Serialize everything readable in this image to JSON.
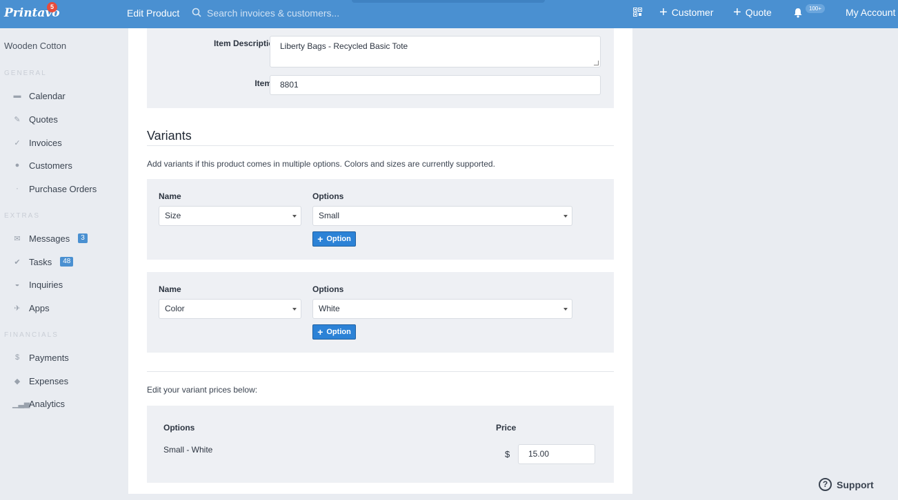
{
  "app": {
    "logo": "Printavo",
    "logo_badge": "5",
    "page_title": "Edit Product"
  },
  "search": {
    "placeholder": "Search invoices & customers..."
  },
  "topnav": {
    "customer": "Customer",
    "quote": "Quote",
    "notifications_badge": "100+",
    "account": "My Account"
  },
  "sidebar": {
    "account_name": "Wooden Cotton",
    "sections": {
      "general": "GENERAL",
      "extras": "EXTRAS",
      "financials": "FINANCIALS"
    },
    "items": {
      "calendar": "Calendar",
      "quotes": "Quotes",
      "invoices": "Invoices",
      "customers": "Customers",
      "purchase_orders": "Purchase Orders",
      "messages": "Messages",
      "messages_count": "3",
      "tasks": "Tasks",
      "tasks_count": "48",
      "inquiries": "Inquiries",
      "apps": "Apps",
      "payments": "Payments",
      "expenses": "Expenses",
      "analytics": "Analytics"
    }
  },
  "product": {
    "description_label": "Item Description",
    "description_value": "Liberty Bags - Recycled Basic Tote",
    "item_number_label": "Item #",
    "item_number_value": "8801"
  },
  "variants": {
    "title": "Variants",
    "hint": "Add variants if this product comes in multiple options. Colors and sizes are currently supported.",
    "name_label": "Name",
    "options_label": "Options",
    "add_option_label": "Option",
    "rows": [
      {
        "name": "Size",
        "option": "Small"
      },
      {
        "name": "Color",
        "option": "White"
      }
    ]
  },
  "prices": {
    "hint": "Edit your variant prices below:",
    "options_header": "Options",
    "price_header": "Price",
    "currency": "$",
    "rows": [
      {
        "option": "Small - White",
        "price": "15.00"
      }
    ]
  },
  "support": {
    "label": "Support"
  }
}
